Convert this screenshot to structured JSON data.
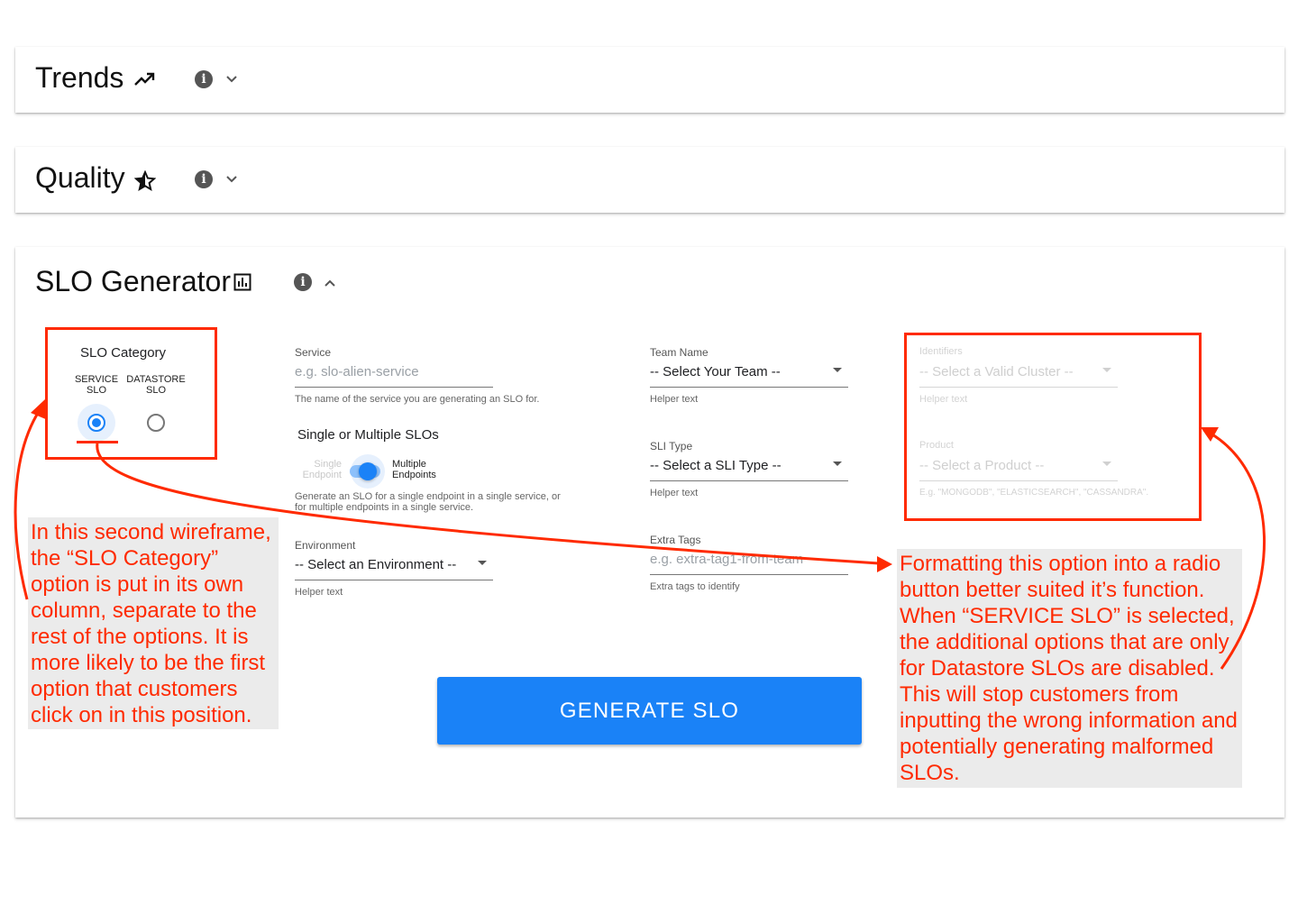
{
  "sections": {
    "trends": {
      "title": "Trends",
      "icon": "trending-up-icon"
    },
    "quality": {
      "title": "Quality",
      "icon": "star-half-icon"
    },
    "slo": {
      "title": "SLO Generator",
      "icon": "bar-chart-icon"
    }
  },
  "info_glyph": "i",
  "slo_category": {
    "title": "SLO Category",
    "options": [
      {
        "label_line1": "SERVICE",
        "label_line2": "SLO",
        "selected": true
      },
      {
        "label_line1": "DATASTORE",
        "label_line2": "SLO",
        "selected": false
      }
    ]
  },
  "service": {
    "label": "Service",
    "placeholder": "e.g. slo-alien-service",
    "helper": "The name of the service you are generating an SLO for."
  },
  "multi_slo": {
    "title": "Single or Multiple SLOs",
    "left_line1": "Single",
    "left_line2": "Endpoint",
    "right_line1": "Multiple",
    "right_line2": "Endpoints",
    "helper_line1": "Generate an SLO for a single endpoint in a single service, or",
    "helper_line2": "for multiple endpoints in a single service.",
    "selected": "Multiple Endpoints"
  },
  "environment": {
    "label": "Environment",
    "value": "-- Select an Environment --",
    "helper": "Helper text"
  },
  "team": {
    "label": "Team Name",
    "value": "-- Select Your Team --",
    "helper": "Helper text"
  },
  "sli_type": {
    "label": "SLI Type",
    "value": "-- Select a SLI Type --",
    "helper": "Helper text"
  },
  "extra_tags": {
    "label": "Extra Tags",
    "placeholder": "e.g. extra-tag1-from-team",
    "helper": "Extra tags to identify"
  },
  "identifiers": {
    "label": "Identifiers",
    "value": "-- Select a Valid Cluster --",
    "helper": "Helper text"
  },
  "product": {
    "label": "Product",
    "value": "-- Select a Product --",
    "helper": "E.g. \"MONGODB\", \"ELASTICSEARCH\", \"CASSANDRA\"."
  },
  "generate_button": "GENERATE SLO",
  "annotations": {
    "left_note": [
      "In this second wireframe,",
      "the “SLO Category”",
      "option is put in its own",
      "column, separate to the",
      "rest of the options. It is",
      "more likely to be the first",
      "option that customers",
      "click on in this position."
    ],
    "right_note": [
      "Formatting this option into a radio",
      "button better suited it’s function.",
      "When “SERVICE SLO” is selected,",
      "the additional options that are only",
      "for Datastore SLOs are disabled.",
      "This will stop customers from",
      "inputting the wrong information and",
      "potentially generating malformed",
      "SLOs."
    ]
  },
  "colors": {
    "accent": "#1a82f7",
    "annotation_red": "#ff2a00",
    "note_bg": "#ebebeb"
  }
}
